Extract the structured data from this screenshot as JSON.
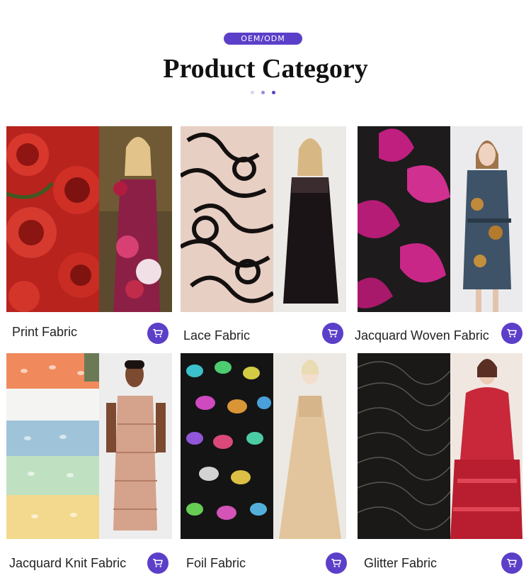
{
  "header": {
    "badge": "OEM/ODM",
    "title": "Product Category",
    "dot_colors": [
      "#d9d3f5",
      "#9d8be0",
      "#5b3fc9"
    ]
  },
  "accent_color": "#5b3fc9",
  "products": [
    {
      "label": "Print Fabric",
      "icon": "cart-icon"
    },
    {
      "label": "Lace Fabric",
      "icon": "cart-icon"
    },
    {
      "label": "Jacquard Woven Fabric",
      "icon": "cart-icon"
    },
    {
      "label": "Jacquard Knit Fabric",
      "icon": "cart-icon"
    },
    {
      "label": "Foil Fabric",
      "icon": "cart-icon"
    },
    {
      "label": "Glitter Fabric",
      "icon": "cart-icon"
    }
  ]
}
